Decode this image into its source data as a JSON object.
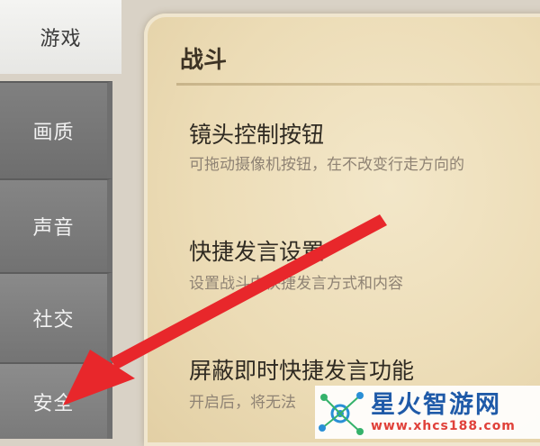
{
  "sidebar": {
    "tabs": [
      {
        "label": "游戏",
        "active": true
      },
      {
        "label": "画质",
        "active": false
      },
      {
        "label": "声音",
        "active": false
      },
      {
        "label": "社交",
        "active": false
      },
      {
        "label": "安全",
        "active": false
      }
    ]
  },
  "panel": {
    "title": "战斗",
    "settings": [
      {
        "title": "镜头控制按钮",
        "desc": "可拖动摄像机按钮，在不改变行走方向的"
      },
      {
        "title": "快捷发言设置",
        "desc": "设置战斗内快捷发言方式和内容"
      },
      {
        "title": "屏蔽即时快捷发言功能",
        "desc": "开启后，将无法"
      }
    ]
  },
  "overlay": {
    "arrow_color": "#e8272b"
  },
  "watermark": {
    "name": "星火智游网",
    "url": "www.xhcs188.com"
  }
}
